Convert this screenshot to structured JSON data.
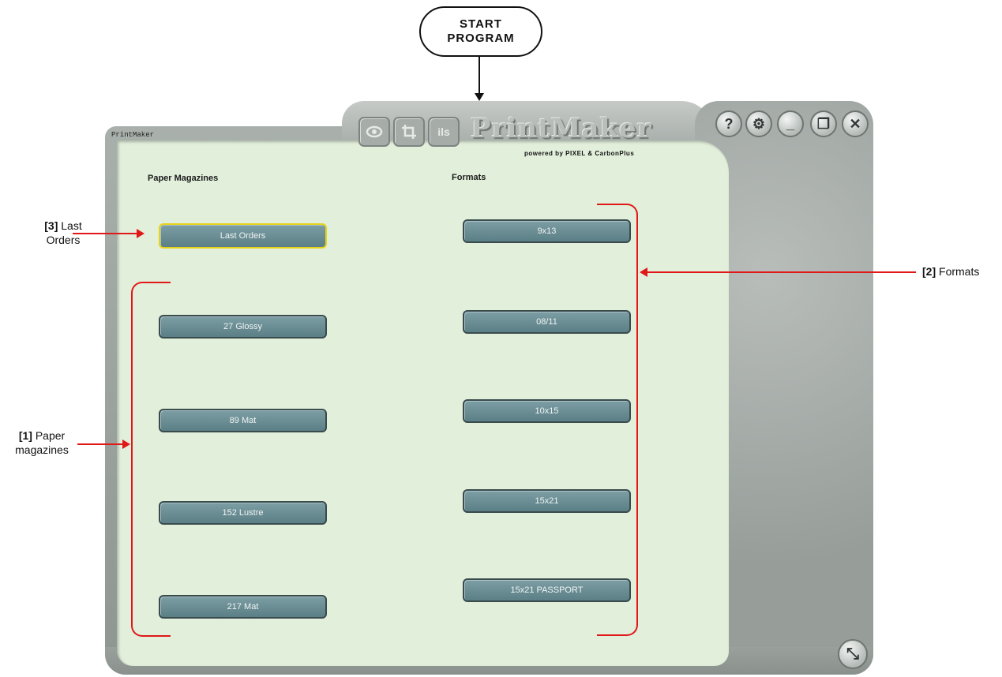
{
  "start": {
    "line1": "START",
    "line2": "PROGRAM"
  },
  "window": {
    "title": "PrintMaker"
  },
  "logo": {
    "icons": [
      "eye-icon",
      "crop-icon",
      "ils-icon"
    ],
    "ils_text": "ils",
    "name": "PrintMaker",
    "subtitle": "powered by PIXEL & CarbonPlus"
  },
  "controls": {
    "help": "?",
    "settings": "⚙",
    "minimize": "_",
    "maximize": "❐",
    "close": "✕",
    "resize": "⤡"
  },
  "paper_magazines": {
    "heading": "Paper Magazines",
    "last_orders": "Last Orders",
    "items": [
      "27 Glossy",
      "89 Mat",
      "152 Lustre",
      "217 Mat"
    ]
  },
  "formats": {
    "heading": "Formats",
    "items": [
      "9x13",
      "08/11",
      "10x15",
      "15x21",
      "15x21 PASSPORT"
    ]
  },
  "annotations": {
    "last_orders_num": "[3]",
    "last_orders_l1": "Last",
    "last_orders_l2": "Orders",
    "formats_num": "[2]",
    "formats_label": "Formats",
    "paper_num": "[1]",
    "paper_l1": "Paper",
    "paper_l2": "magazines"
  },
  "colors": {
    "accent_red": "#e01818",
    "button_teal": "#6a8c92",
    "content_bg": "#e2efdb",
    "selected_border": "#e6d21a"
  }
}
